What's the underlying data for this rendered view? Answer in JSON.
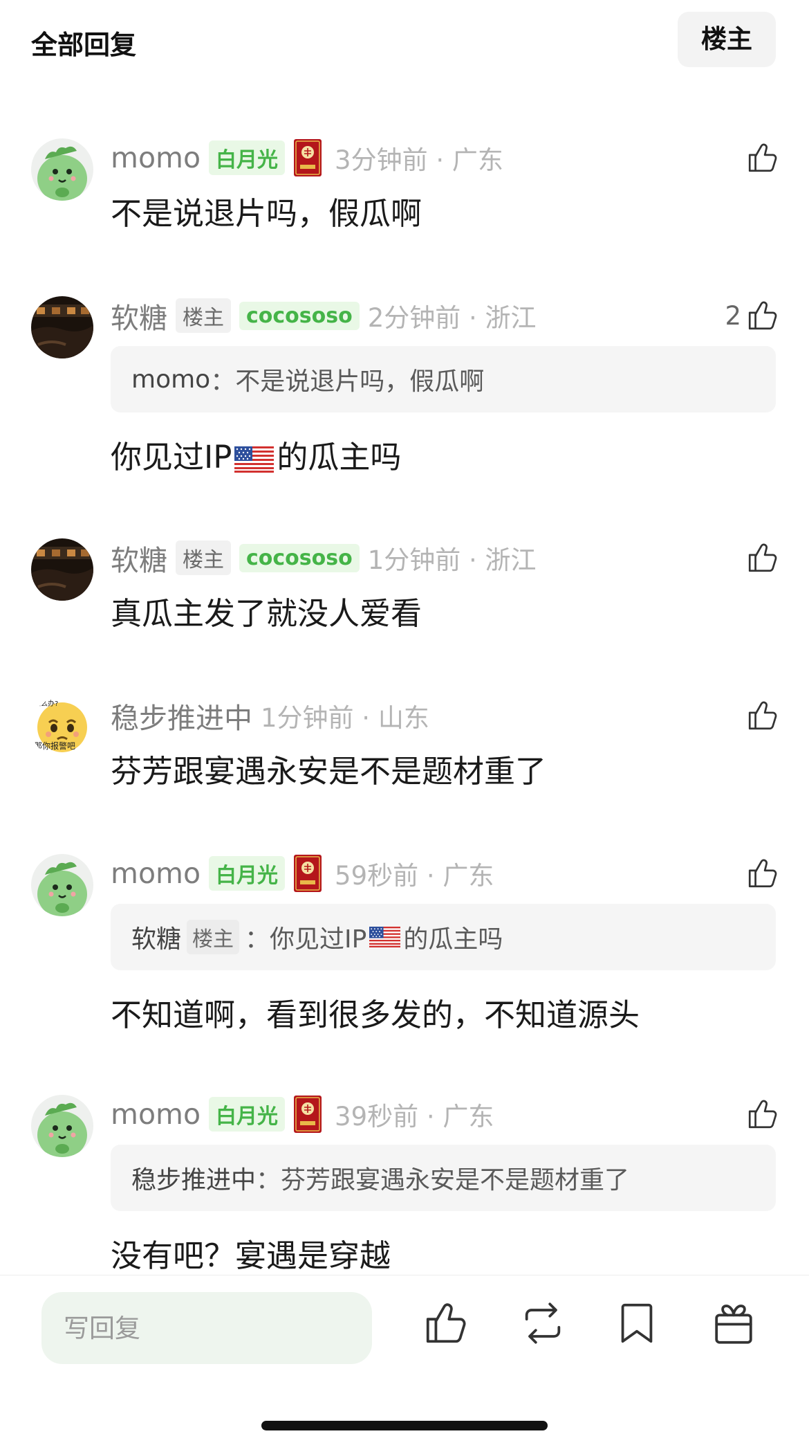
{
  "header": {
    "title": "全部回复",
    "owner_filter_label": "楼主"
  },
  "comments": [
    {
      "username": "momo",
      "badge_fan": "白月光",
      "time_location": "3分钟前 · 广东",
      "like_count": "",
      "text": "不是说退片吗，假瓜啊"
    },
    {
      "username": "软糖",
      "badge_op": "楼主",
      "badge_fan": "cocososo",
      "time_location": "2分钟前 · 浙江",
      "like_count": "2",
      "quote_user": "momo",
      "quote_text": "：不是说退片吗，假瓜啊",
      "text_before_flag": "你见过IP",
      "text_after_flag": "的瓜主吗"
    },
    {
      "username": "软糖",
      "badge_op": "楼主",
      "badge_fan": "cocososo",
      "time_location": "1分钟前 · 浙江",
      "like_count": "",
      "text": "真瓜主发了就没人爱看"
    },
    {
      "username": "稳步推进中",
      "avatar_text_top": "怎么办?",
      "avatar_text_bottom": "那你报警吧",
      "time_location": "1分钟前 · 山东",
      "like_count": "",
      "text": "芬芳跟宴遇永安是不是题材重了"
    },
    {
      "username": "momo",
      "badge_fan": "白月光",
      "time_location": "59秒前 · 广东",
      "like_count": "",
      "quote_user": "软糖",
      "quote_badge": "楼主",
      "quote_text_before_flag": "：你见过IP",
      "quote_text_after_flag": "的瓜主吗",
      "text": "不知道啊，看到很多发的，不知道源头"
    },
    {
      "username": "momo",
      "badge_fan": "白月光",
      "time_location": "39秒前 · 广东",
      "like_count": "",
      "quote_user": "稳步推进中",
      "quote_text": "：芬芳跟宴遇永安是不是题材重了",
      "text": "没有吧？宴遇是穿越"
    }
  ],
  "bottom_bar": {
    "reply_placeholder": "写回复"
  },
  "colors": {
    "accent_green": "#45b448",
    "badge_green_bg": "#e9f8e6",
    "medal_red": "#b4161b",
    "meta_gray": "#b4b4b4"
  },
  "icons": [
    "thumbs-up-icon",
    "repost-icon",
    "bookmark-icon",
    "gift-icon",
    "us-flag-icon",
    "medal-icon"
  ]
}
